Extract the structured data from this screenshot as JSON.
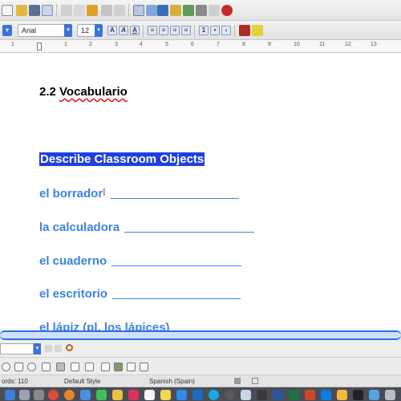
{
  "toolbar": {
    "style_combo": "",
    "font_name": "Arial",
    "font_size": "12"
  },
  "ruler": {
    "numbers": [
      "1",
      "1",
      "2",
      "3",
      "4",
      "5",
      "6",
      "7",
      "8",
      "9",
      "10",
      "11",
      "12",
      "13"
    ]
  },
  "document": {
    "heading_number": "2.2",
    "heading_word": "Vocabulario",
    "section_title": "Describe Classroom Objects",
    "vocab_items": [
      "el borrador",
      "la calculadora",
      "el cuaderno",
      "el escritorio",
      "el lápiz (pl. los lápices)"
    ]
  },
  "statusbar": {
    "words": "ords: 110",
    "page_style": "Default Style",
    "language": "Spanish (Spain)"
  },
  "colors": {
    "accent": "#3a74d8",
    "vocab_text": "#3c82e6",
    "selection": "#1f3fe0"
  }
}
